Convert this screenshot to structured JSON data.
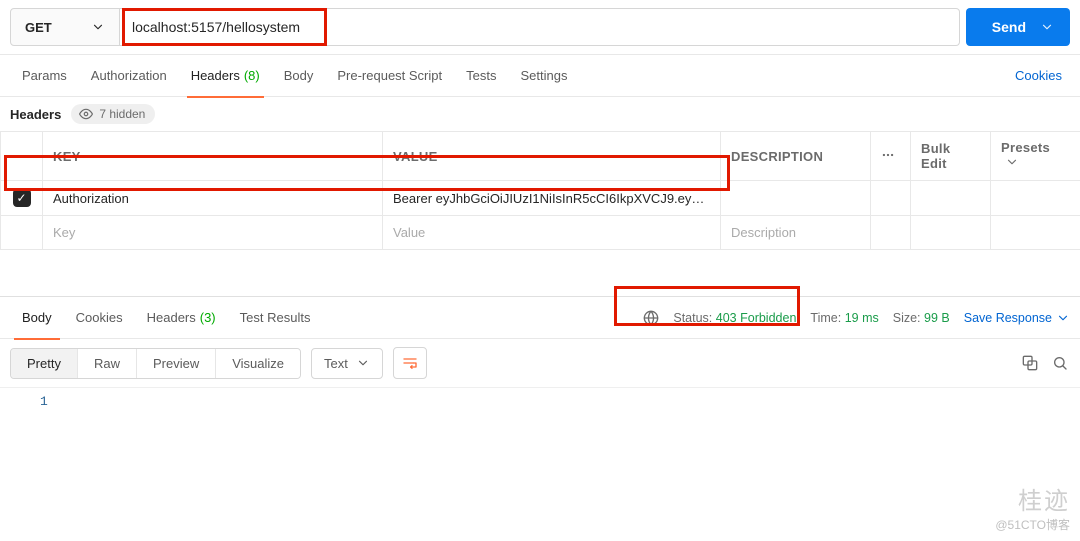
{
  "request": {
    "method": "GET",
    "url": "localhost:5157/hellosystem",
    "send_label": "Send"
  },
  "tabs": {
    "params": "Params",
    "authorization": "Authorization",
    "headers": "Headers",
    "headers_count": "(8)",
    "body": "Body",
    "prerequest": "Pre-request Script",
    "tests": "Tests",
    "settings": "Settings",
    "cookies": "Cookies"
  },
  "headers_panel": {
    "title": "Headers",
    "hidden_label": "7 hidden",
    "columns": {
      "key": "KEY",
      "value": "VALUE",
      "description": "DESCRIPTION",
      "bulk": "Bulk Edit",
      "presets": "Presets"
    },
    "rows": [
      {
        "enabled": true,
        "key": "Authorization",
        "value": "Bearer eyJhbGciOiJIUzI1NiIsInR5cCI6IkpXVCJ9.eyJod..."
      }
    ],
    "blank": {
      "key": "Key",
      "value": "Value",
      "description": "Description"
    }
  },
  "response_tabs": {
    "body": "Body",
    "cookies": "Cookies",
    "headers": "Headers",
    "headers_count": "(3)",
    "test_results": "Test Results"
  },
  "response_meta": {
    "status_label": "Status:",
    "status_code": "403",
    "status_text": "Forbidden",
    "time_label": "Time:",
    "time_value": "19 ms",
    "size_label": "Size:",
    "size_value": "99 B",
    "save_response": "Save Response"
  },
  "response_toolbar": {
    "pretty": "Pretty",
    "raw": "Raw",
    "preview": "Preview",
    "visualize": "Visualize",
    "lang": "Text"
  },
  "response_body": {
    "line1": "1"
  },
  "watermark": {
    "hanzi": "桂迹",
    "credit": "@51CTO博客"
  }
}
